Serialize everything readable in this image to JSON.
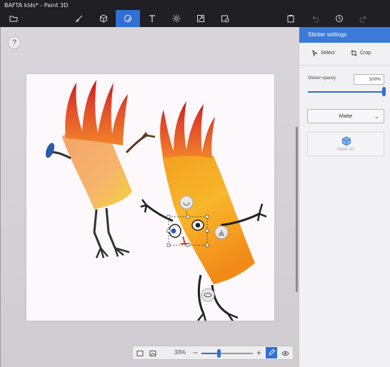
{
  "window": {
    "title": "BAFTA kids* - Paint 3D"
  },
  "toolbar": {
    "items": [
      "menu",
      "brushes",
      "3d-shapes",
      "stickers",
      "text",
      "effects",
      "canvas",
      "library"
    ],
    "active": "stickers",
    "right": [
      "paste",
      "undo",
      "history",
      "redo"
    ]
  },
  "canvas": {
    "help_glyph": "?"
  },
  "viewbar": {
    "zoom_label": "33%",
    "zoom_fraction": 0.33,
    "minus": "−",
    "plus": "+"
  },
  "panel": {
    "title": "Sticker settings",
    "select_label": "Select",
    "crop_label": "Crop",
    "opacity_label": "Sticker opacity",
    "opacity_value": "100%",
    "finish_value": "Matte",
    "make3d_label": "Make 3D"
  },
  "colors": {
    "accent": "#2f6fd6",
    "panel_header": "#3b7ad9"
  }
}
